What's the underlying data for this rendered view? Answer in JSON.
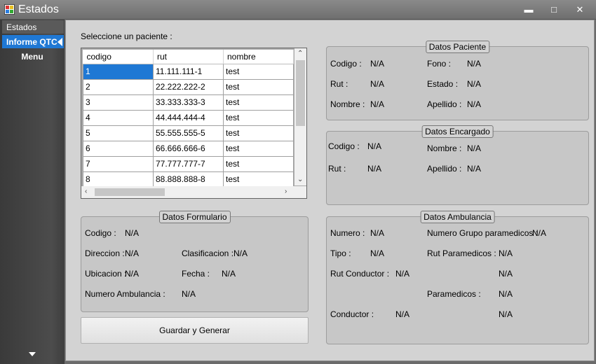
{
  "window": {
    "title": "Estados",
    "minimize_icon": "minimize-icon",
    "maximize_icon": "maximize-icon",
    "close_icon": "close-icon"
  },
  "sidebar": {
    "items": [
      {
        "label": "Estados"
      },
      {
        "label": "Informe QTC"
      }
    ],
    "menu_label": "Menu"
  },
  "patient_select": {
    "label": "Seleccione un paciente :",
    "columns": [
      "codigo",
      "rut",
      "nombre"
    ],
    "rows": [
      [
        "1",
        "11.111.111-1",
        "test"
      ],
      [
        "2",
        "22.222.222-2",
        "test"
      ],
      [
        "3",
        "33.333.333-3",
        "test"
      ],
      [
        "4",
        "44.444.444-4",
        "test"
      ],
      [
        "5",
        "55.555.555-5",
        "test"
      ],
      [
        "6",
        "66.666.666-6",
        "test"
      ],
      [
        "7",
        "77.777.777-7",
        "test"
      ],
      [
        "8",
        "88.888.888-8",
        "test"
      ]
    ],
    "selected_row": 0
  },
  "datos_paciente": {
    "title": "Datos Paciente",
    "codigo_label": "Codigo :",
    "codigo": "N/A",
    "rut_label": "Rut :",
    "rut": "N/A",
    "nombre_label": "Nombre :",
    "nombre": "N/A",
    "fono_label": "Fono :",
    "fono": "N/A",
    "estado_label": "Estado :",
    "estado": "N/A",
    "apellido_label": "Apellido :",
    "apellido": "N/A"
  },
  "datos_encargado": {
    "title": "Datos Encargado",
    "codigo_label": "Codigo :",
    "codigo": "N/A",
    "rut_label": "Rut :",
    "rut": "N/A",
    "nombre_label": "Nombre :",
    "nombre": "N/A",
    "apellido_label": "Apellido :",
    "apellido": "N/A"
  },
  "datos_formulario": {
    "title": "Datos Formulario",
    "codigo_label": "Codigo :",
    "codigo": "N/A",
    "direccion_label": "Direccion :",
    "direccion": "N/A",
    "clasificacion_label": "Clasificacion :",
    "clasificacion": "N/A",
    "ubicacion_label": "Ubicacion :",
    "ubicacion": "N/A",
    "fecha_label": "Fecha :",
    "fecha": "N/A",
    "numero_ambulancia_label": "Numero Ambulancia :",
    "numero_ambulancia": "N/A"
  },
  "datos_ambulancia": {
    "title": "Datos Ambulancia",
    "numero_label": "Numero :",
    "numero": "N/A",
    "tipo_label": "Tipo :",
    "tipo": "N/A",
    "rut_conductor_label": "Rut Conductor :",
    "rut_conductor": "N/A",
    "conductor_label": "Conductor :",
    "conductor": "N/A",
    "numero_grupo_label": "Numero Grupo paramedicos :",
    "numero_grupo": "N/A",
    "rut_paramedicos_label": "Rut Paramedicos :",
    "rut_paramedicos": "N/A",
    "rut_paramedicos_2": "N/A",
    "paramedicos_label": "Paramedicos :",
    "paramedicos": "N/A",
    "paramedicos_2": "N/A"
  },
  "actions": {
    "generate_label": "Guardar y Generar"
  }
}
